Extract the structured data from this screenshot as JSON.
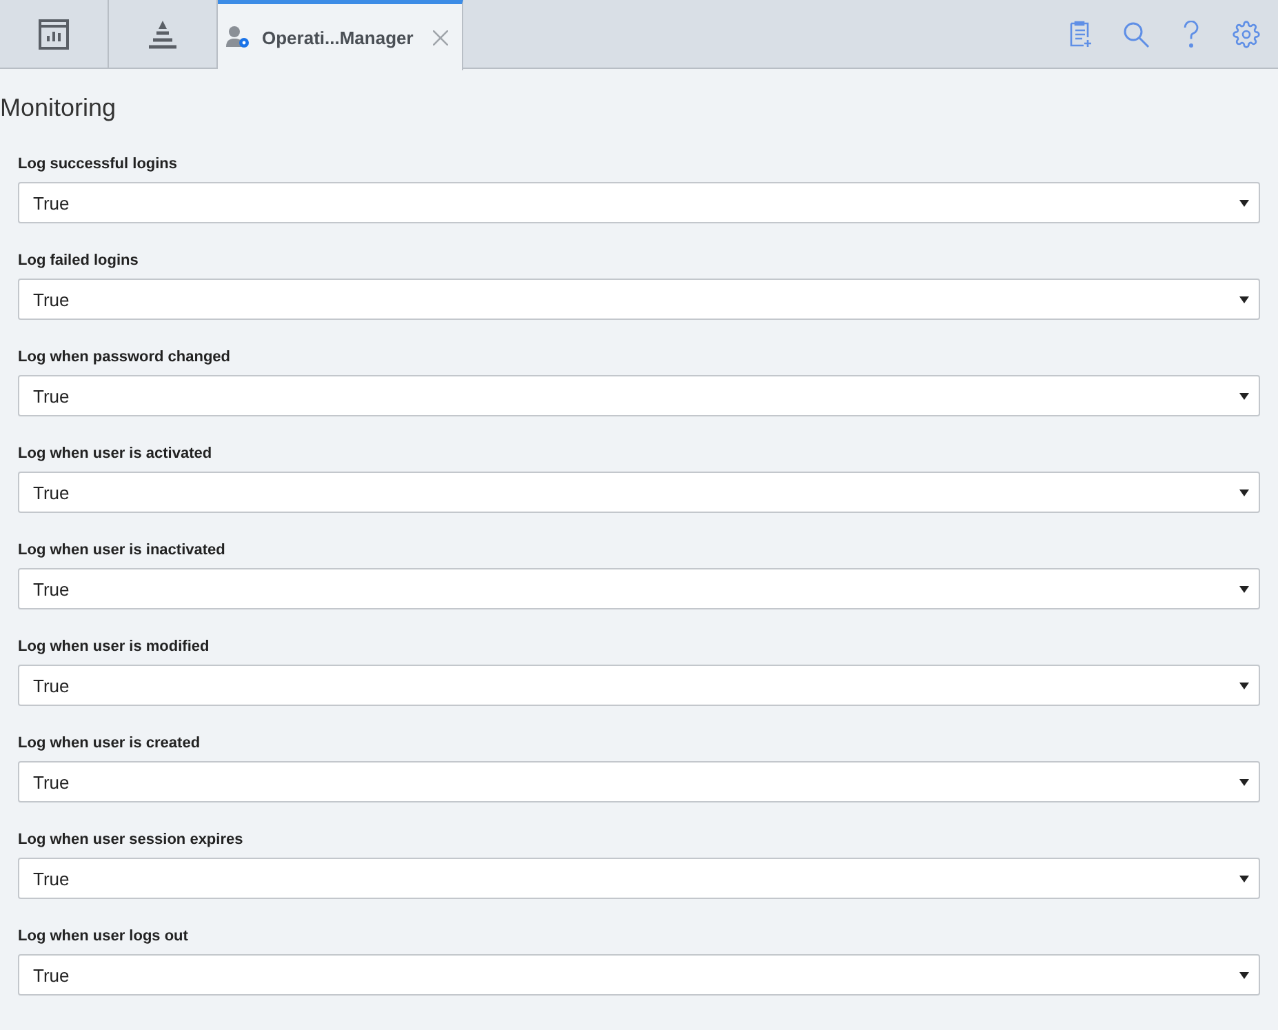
{
  "tabs": [
    {
      "kind": "chart",
      "selected": false
    },
    {
      "kind": "pyramid",
      "selected": false
    },
    {
      "kind": "document",
      "label": "Operati...Manager",
      "selected": true
    }
  ],
  "toolbar": [
    {
      "kind": "clipboard-add"
    },
    {
      "kind": "search"
    },
    {
      "kind": "help"
    },
    {
      "kind": "settings"
    }
  ],
  "title": "Monitoring",
  "fields": [
    {
      "label": "Log successful logins",
      "value": "True"
    },
    {
      "label": "Log failed logins",
      "value": "True"
    },
    {
      "label": "Log when password changed",
      "value": "True"
    },
    {
      "label": "Log when user is activated",
      "value": "True"
    },
    {
      "label": "Log when user is inactivated",
      "value": "True"
    },
    {
      "label": "Log when user is modified",
      "value": "True"
    },
    {
      "label": "Log when user is created",
      "value": "True"
    },
    {
      "label": "Log when user session expires",
      "value": "True"
    },
    {
      "label": "Log when user logs out",
      "value": "True"
    }
  ]
}
